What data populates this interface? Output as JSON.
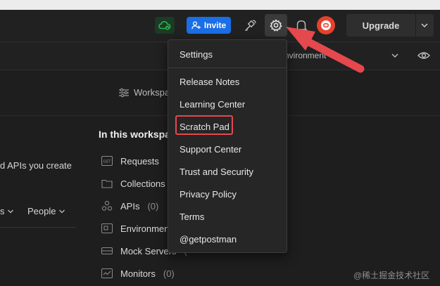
{
  "header": {
    "invite_label": "Invite",
    "upgrade_label": "Upgrade"
  },
  "subbar": {
    "environment_text": "nvironment"
  },
  "workspace": {
    "link_label": "Workspa",
    "section_title": "In this workspa",
    "left_description": "d APIs you create",
    "filter_left_label": "s",
    "filter_people_label": "People",
    "items": [
      {
        "label": "Requests",
        "count": "",
        "icon": "get-request-icon"
      },
      {
        "label": "Collections",
        "count": "",
        "icon": "collection-icon"
      },
      {
        "label": "APIs",
        "count": "(0)",
        "icon": "api-icon"
      },
      {
        "label": "Environmen",
        "count": "",
        "icon": "environment-icon"
      },
      {
        "label": "Mock Servers",
        "count": "(",
        "icon": "mock-server-icon"
      },
      {
        "label": "Monitors",
        "count": "(0)",
        "icon": "monitor-icon"
      }
    ]
  },
  "settings_menu": {
    "header_item": "Settings",
    "items": [
      "Release Notes",
      "Learning Center",
      "Scratch Pad",
      "Support Center",
      "Trust and Security",
      "Privacy Policy",
      "Terms",
      "@getpostman"
    ],
    "highlighted_item": "Scratch Pad"
  },
  "icon_get_text": "GET",
  "watermark": "@稀土掘金技术社区",
  "colors": {
    "accent_blue": "#1a6ee6",
    "highlight_red": "#e5484d",
    "avatar_orange": "#e7412c",
    "sync_green": "#2bb24c"
  }
}
